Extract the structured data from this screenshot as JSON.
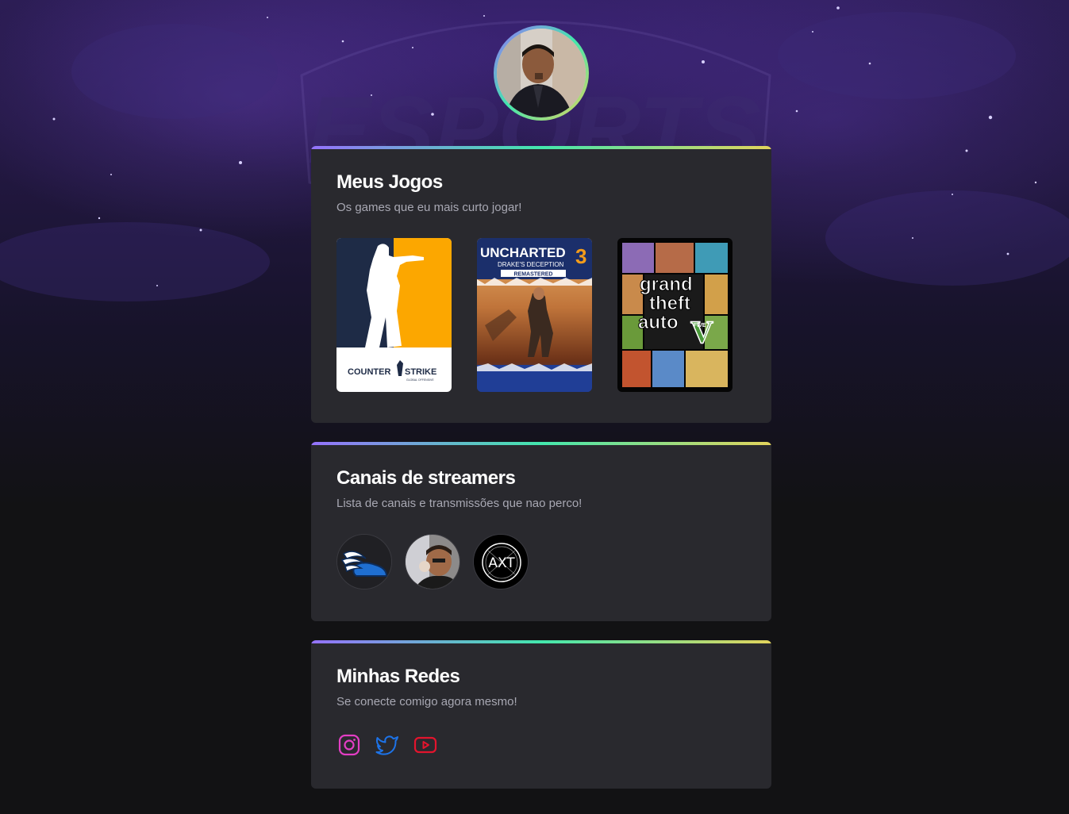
{
  "profile": {
    "avatar_alt": "Foto de perfil"
  },
  "background": {
    "watermark": "ESPORTS"
  },
  "games_section": {
    "title": "Meus Jogos",
    "subtitle": "Os games que eu mais curto jogar!",
    "games": [
      {
        "name": "Counter-Strike: Global Offensive",
        "logo_a": "COUNTER",
        "logo_b": "STRIKE",
        "logo_c": "GLOBAL OFFENSIVE",
        "accent": "#fca700",
        "bg": "#1e2b46"
      },
      {
        "name": "Uncharted 3",
        "title": "UNCHARTED",
        "number": "3",
        "subtitle": "DRAKE'S DECEPTION",
        "edition": "REMASTERED",
        "accent": "#f39c1b"
      },
      {
        "name": "Grand Theft Auto V",
        "line1": "grand",
        "line2": "theft",
        "line3": "auto",
        "numeral": "V",
        "five": "FIVE"
      }
    ]
  },
  "streamers_section": {
    "title": "Canais de streamers",
    "subtitle": "Lista de canais e transmissões que nao perco!",
    "streamers": [
      {
        "name": "streamer-wing-shoe",
        "icon": "winged-shoe-icon"
      },
      {
        "name": "streamer-face",
        "icon": "person-photo"
      },
      {
        "name": "streamer-axt",
        "label": "AXT"
      }
    ]
  },
  "social_section": {
    "title": "Minhas Redes",
    "subtitle": "Se conecte comigo agora mesmo!",
    "links": [
      {
        "name": "instagram",
        "icon": "instagram-icon",
        "color": "#e33ec4"
      },
      {
        "name": "twitter",
        "icon": "twitter-icon",
        "color": "#1d73e8"
      },
      {
        "name": "youtube",
        "icon": "youtube-icon",
        "color": "#e3142d"
      }
    ]
  },
  "colors": {
    "page_bg": "#121214",
    "card_bg": "#29292e",
    "gradient": [
      "#9572fc",
      "#43e7ad",
      "#e2d45c"
    ],
    "text_primary": "#ffffff",
    "text_secondary": "#a8a8b3"
  }
}
